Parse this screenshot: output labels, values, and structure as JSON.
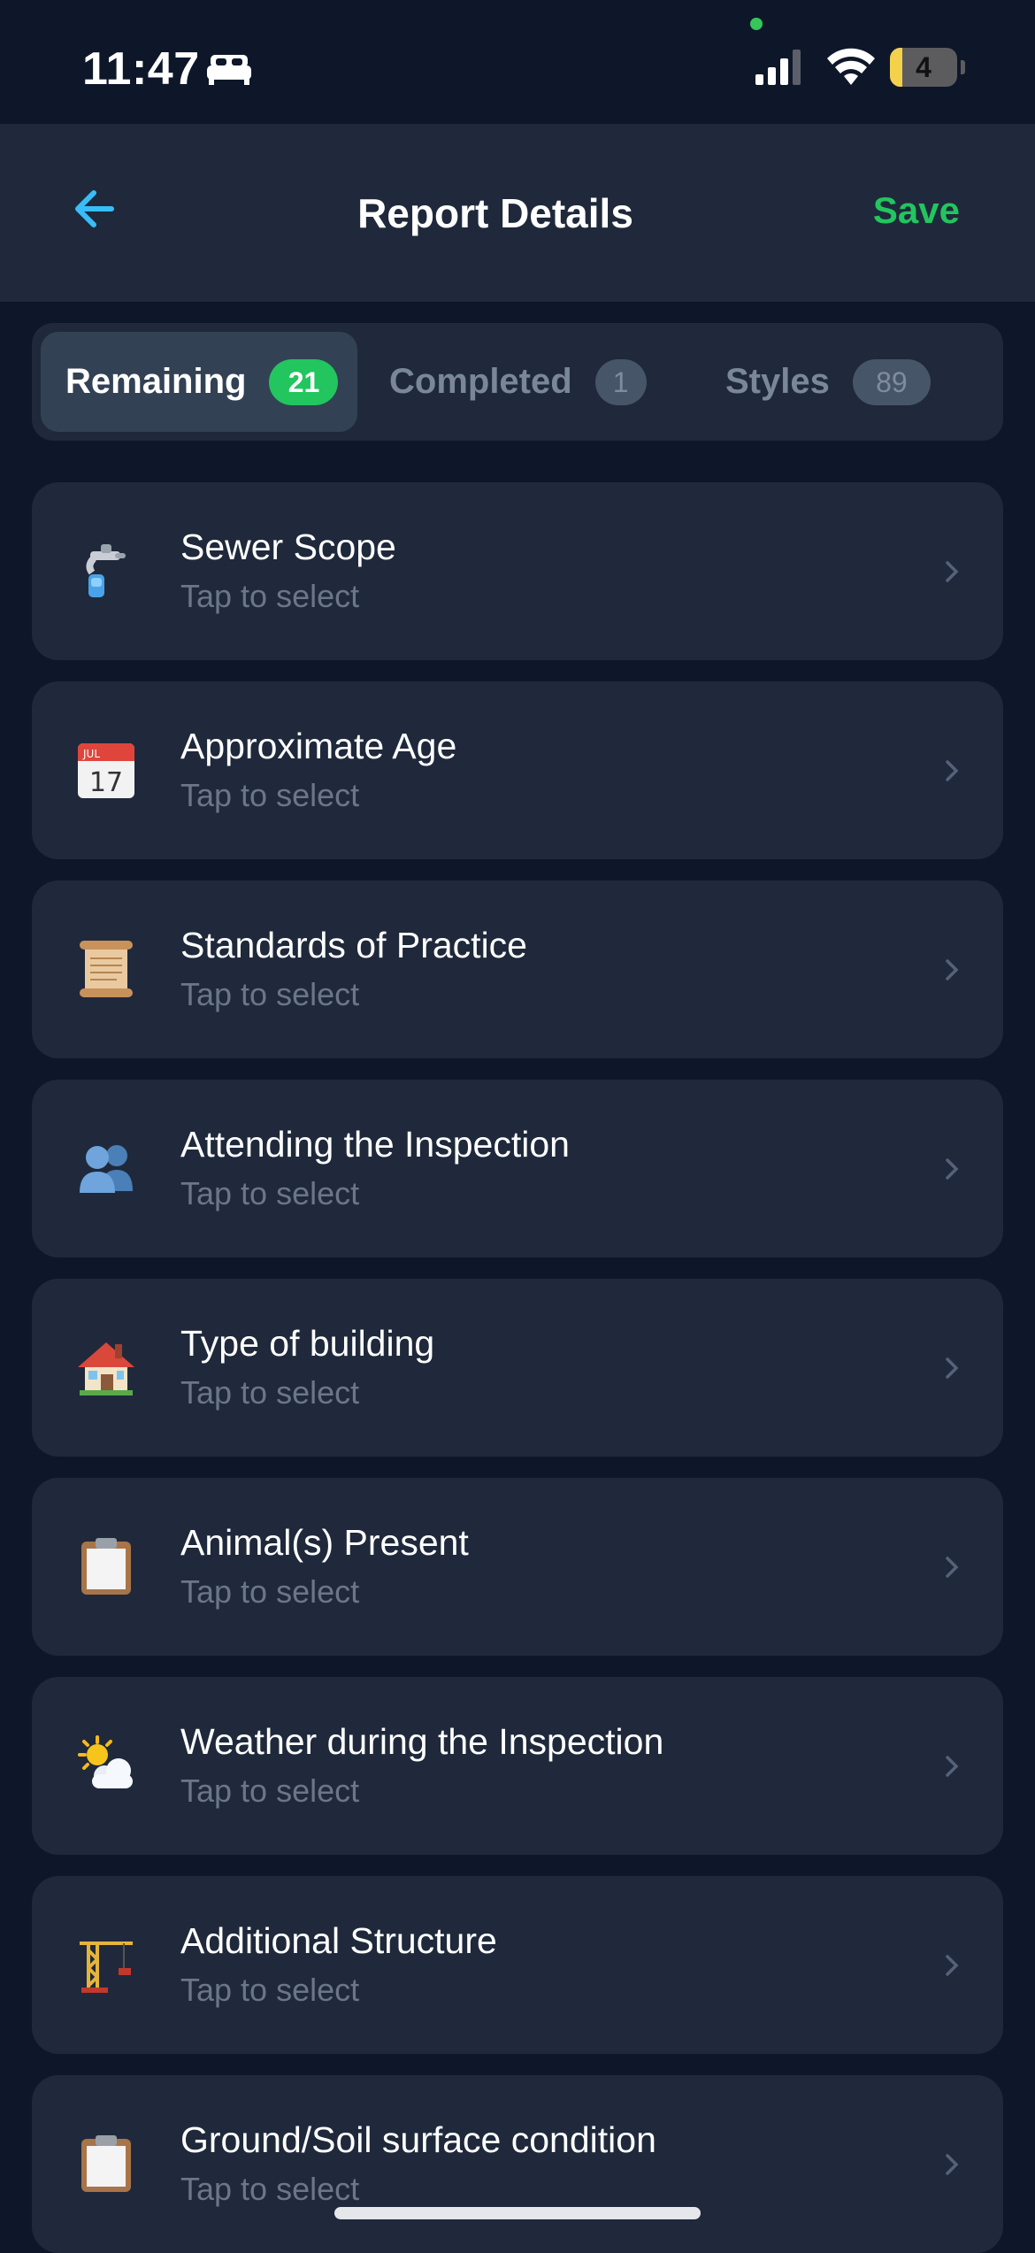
{
  "status_bar": {
    "time": "11:47",
    "battery_level": "4",
    "battery_fraction": 0.18,
    "icons": [
      "bed-icon",
      "signal-icon",
      "wifi-icon",
      "battery-icon"
    ]
  },
  "header": {
    "title": "Report Details",
    "save_label": "Save",
    "back_icon": "arrow-left-icon"
  },
  "tabs": [
    {
      "label": "Remaining",
      "count": "21",
      "active": true
    },
    {
      "label": "Completed",
      "count": "1",
      "active": false
    },
    {
      "label": "Styles",
      "count": "89",
      "active": false
    }
  ],
  "items": [
    {
      "name": "Sewer Scope",
      "hint": "Tap to select",
      "icon": "faucet-icon"
    },
    {
      "name": "Approximate Age",
      "hint": "Tap to select",
      "icon": "calendar-icon",
      "calendar_month": "JUL",
      "calendar_day": "17"
    },
    {
      "name": "Standards of Practice",
      "hint": "Tap to select",
      "icon": "scroll-icon"
    },
    {
      "name": "Attending the Inspection",
      "hint": "Tap to select",
      "icon": "people-icon"
    },
    {
      "name": "Type of building",
      "hint": "Tap to select",
      "icon": "house-icon"
    },
    {
      "name": "Animal(s) Present",
      "hint": "Tap to select",
      "icon": "clipboard-icon"
    },
    {
      "name": "Weather during the Inspection",
      "hint": "Tap to select",
      "icon": "sun-cloud-icon"
    },
    {
      "name": "Additional Structure",
      "hint": "Tap to select",
      "icon": "crane-icon"
    },
    {
      "name": "Ground/Soil surface condition",
      "hint": "Tap to select",
      "icon": "clipboard-icon"
    }
  ],
  "colors": {
    "background": "#0e172a",
    "card": "#1f293b",
    "accent_green": "#22c55e",
    "back_arrow": "#38bdf8",
    "muted_text": "#6b7687"
  }
}
